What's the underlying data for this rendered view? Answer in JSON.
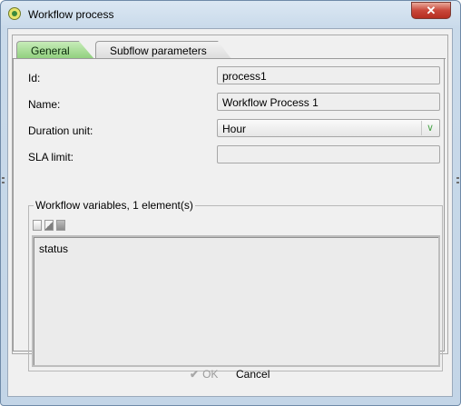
{
  "window": {
    "title": "Workflow process",
    "close_label": "✕"
  },
  "tabs": [
    {
      "label": "General",
      "active": true
    },
    {
      "label": "Subflow parameters",
      "active": false
    }
  ],
  "form": {
    "id_label": "Id:",
    "id_value": "process1",
    "name_label": "Name:",
    "name_value": "Workflow Process 1",
    "duration_label": "Duration unit:",
    "duration_value": "Hour",
    "sla_label": "SLA limit:",
    "sla_value": ""
  },
  "variables": {
    "legend": "Workflow variables, 1 element(s)",
    "toolbar_icons": [
      "new-icon",
      "edit-icon",
      "delete-icon"
    ],
    "items": [
      "status"
    ]
  },
  "footer": {
    "ok_label": "OK",
    "cancel_label": "Cancel"
  },
  "colors": {
    "active_tab": "#8fcf7c",
    "close_button": "#c9473a",
    "chevron": "#4ca64c"
  }
}
